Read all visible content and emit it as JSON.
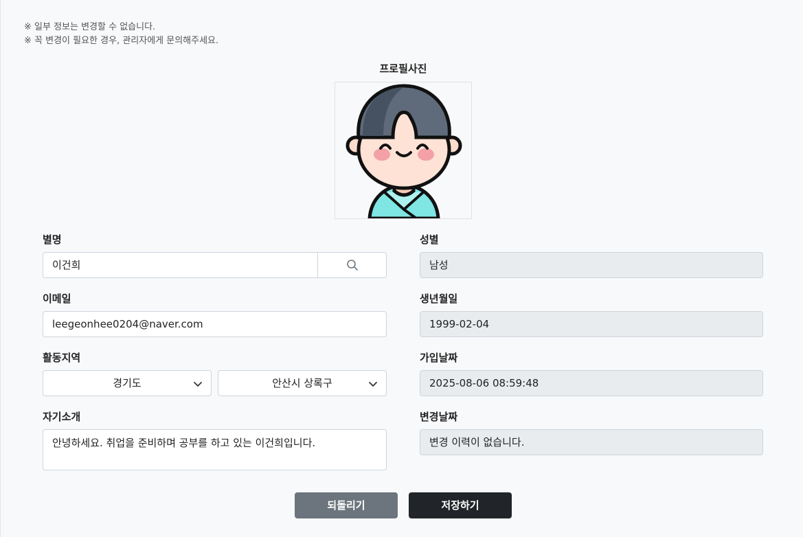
{
  "notice": {
    "line1": "※ 일부 정보는 변경할 수 없습니다.",
    "line2": "※ 꼭 변경이 필요한 경우, 관리자에게 문의해주세요."
  },
  "profile": {
    "title": "프로필사진"
  },
  "form": {
    "nickname": {
      "label": "별명",
      "value": "이건희"
    },
    "gender": {
      "label": "성별",
      "value": "남성"
    },
    "email": {
      "label": "이메일",
      "value": "leegeonhee0204@naver.com"
    },
    "birth": {
      "label": "생년월일",
      "value": "1999-02-04"
    },
    "region": {
      "label": "활동지역",
      "province": "경기도",
      "city": "안산시 상록구"
    },
    "joined": {
      "label": "가입날짜",
      "value": "2025-08-06 08:59:48"
    },
    "intro": {
      "label": "자기소개",
      "value": "안녕하세요. 취업을 준비하며 공부를 하고 있는 이건희입니다."
    },
    "changed": {
      "label": "변경날짜",
      "value": "변경 이력이 없습니다."
    }
  },
  "buttons": {
    "reset": "되돌리기",
    "save": "저장하기"
  },
  "icons": {
    "search": "search-icon",
    "chevron": "chevron-down-icon"
  }
}
